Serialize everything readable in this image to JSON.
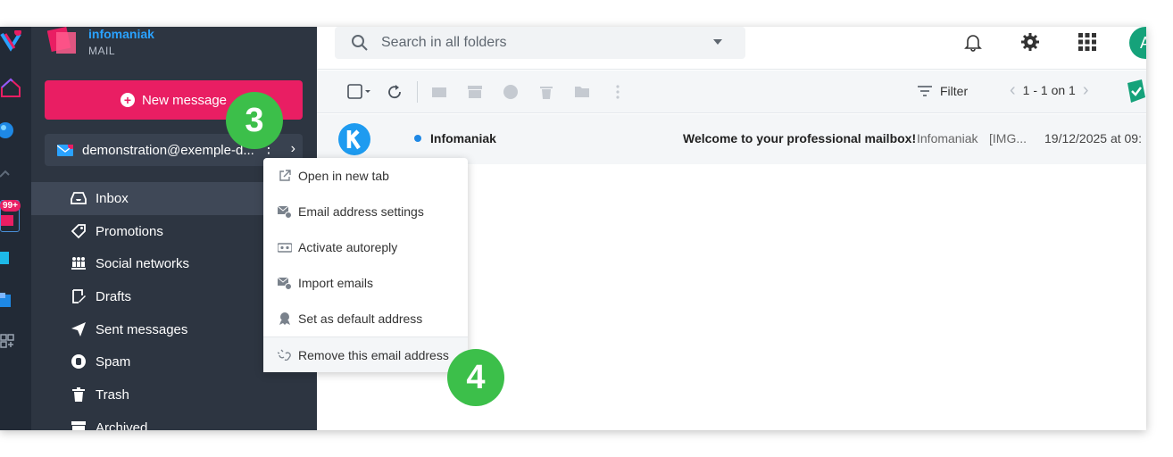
{
  "brand": {
    "name": "infomaniak",
    "product": "MAIL"
  },
  "rail": {
    "badge": "99+"
  },
  "compose": {
    "label": "New message"
  },
  "account": {
    "email": "demonstration@exemple-d..."
  },
  "folders": [
    {
      "label": "Inbox",
      "icon": "inbox-icon",
      "active": true
    },
    {
      "label": "Promotions",
      "icon": "tag-icon"
    },
    {
      "label": "Social networks",
      "icon": "people-icon"
    },
    {
      "label": "Drafts",
      "icon": "draft-icon"
    },
    {
      "label": "Sent messages",
      "icon": "send-icon"
    },
    {
      "label": "Spam",
      "icon": "spam-hand-icon"
    },
    {
      "label": "Trash",
      "icon": "trash-icon"
    },
    {
      "label": "Archived",
      "icon": "archive-icon"
    }
  ],
  "search": {
    "placeholder": "Search in all folders"
  },
  "toolbar": {
    "filter_label": "Filter",
    "pager": "1 - 1 on 1"
  },
  "mail": {
    "from": "Infomaniak",
    "subject": "Welcome to your professional mailbox!",
    "preview": "Infomaniak",
    "tag": "[IMG...",
    "date": "19/12/2025 at 09:"
  },
  "avatar": {
    "initial": "A"
  },
  "context_menu": [
    {
      "label": "Open in new tab",
      "icon": "external-link-icon"
    },
    {
      "label": "Email address settings",
      "icon": "mail-settings-icon"
    },
    {
      "label": "Activate autoreply",
      "icon": "autoreply-icon"
    },
    {
      "label": "Import emails",
      "icon": "mail-import-icon"
    },
    {
      "label": "Set as default address",
      "icon": "award-icon"
    },
    {
      "label": "Remove this email address",
      "icon": "unlink-icon"
    }
  ],
  "steps": {
    "first": "3",
    "second": "4"
  },
  "colors": {
    "accent": "#e91e63",
    "sidebar": "#2d3541",
    "rail": "#222a36",
    "step": "#3cbf4a",
    "link_blue": "#2aa2ff"
  }
}
